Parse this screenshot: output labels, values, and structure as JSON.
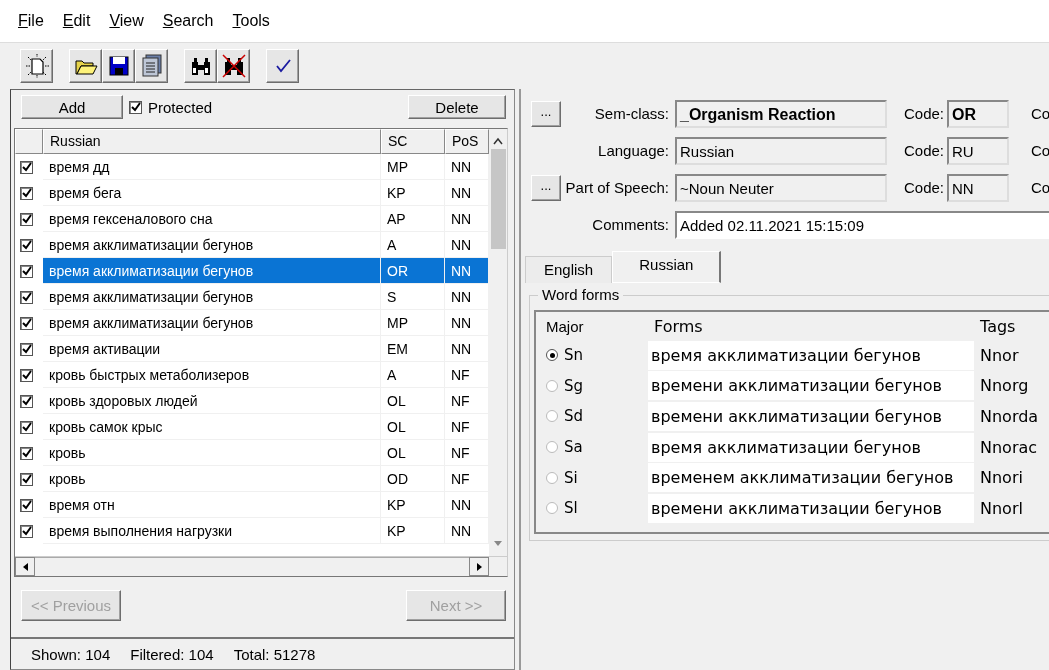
{
  "menu": [
    "File",
    "Edit",
    "View",
    "Search",
    "Tools"
  ],
  "toolbar": [
    [
      {
        "kind": "new"
      }
    ],
    [
      {
        "kind": "open"
      },
      {
        "kind": "save"
      },
      {
        "kind": "save-all"
      }
    ],
    [
      {
        "kind": "find"
      },
      {
        "kind": "find-off"
      }
    ],
    [
      {
        "kind": "check"
      }
    ]
  ],
  "list_panel": {
    "add_button": "Add",
    "protected": {
      "label": "Protected",
      "checked": true
    },
    "delete_button": "Delete",
    "columns": [
      "Russian",
      "SC",
      "PoS"
    ],
    "rows": [
      {
        "checked": true,
        "text": "время дд",
        "sc": "MP",
        "pos": "NN",
        "selected": false
      },
      {
        "checked": true,
        "text": "время бега",
        "sc": "KP",
        "pos": "NN",
        "selected": false
      },
      {
        "checked": true,
        "text": "время гексеналового сна",
        "sc": "AP",
        "pos": "NN",
        "selected": false
      },
      {
        "checked": true,
        "text": "время акклиматизации бегунов",
        "sc": "A",
        "pos": "NN",
        "selected": false
      },
      {
        "checked": true,
        "text": "время акклиматизации бегунов",
        "sc": "OR",
        "pos": "NN",
        "selected": true
      },
      {
        "checked": true,
        "text": "время акклиматизации бегунов",
        "sc": "S",
        "pos": "NN",
        "selected": false
      },
      {
        "checked": true,
        "text": "время акклиматизации бегунов",
        "sc": "MP",
        "pos": "NN",
        "selected": false
      },
      {
        "checked": true,
        "text": "время активации",
        "sc": "EM",
        "pos": "NN",
        "selected": false
      },
      {
        "checked": true,
        "text": "кровь быстрых метаболизеров",
        "sc": "A",
        "pos": "NF",
        "selected": false
      },
      {
        "checked": true,
        "text": "кровь здоровых людей",
        "sc": "OL",
        "pos": "NF",
        "selected": false
      },
      {
        "checked": true,
        "text": "кровь самок крыс",
        "sc": "OL",
        "pos": "NF",
        "selected": false
      },
      {
        "checked": true,
        "text": "кровь",
        "sc": "OL",
        "pos": "NF",
        "selected": false
      },
      {
        "checked": true,
        "text": "кровь",
        "sc": "OD",
        "pos": "NF",
        "selected": false
      },
      {
        "checked": true,
        "text": "время отн",
        "sc": "KP",
        "pos": "NN",
        "selected": false
      },
      {
        "checked": true,
        "text": "время выполнения нагрузки",
        "sc": "KP",
        "pos": "NN",
        "selected": false
      }
    ],
    "nav": [
      {
        "label": "<< Previous",
        "disabled": true
      },
      {
        "label": "Next >>",
        "disabled": true
      }
    ],
    "status": [
      "Shown: 104",
      "Filtered: 104",
      "Total: 51278"
    ]
  },
  "details": {
    "fields": [
      {
        "kind": "lookup",
        "label": "Sem-class:",
        "value": "_Organism Reaction",
        "bold": true,
        "code_label": "Code:",
        "code": "OR",
        "extra": "Co",
        "browse": "..."
      },
      {
        "kind": "plain",
        "label": "Language:",
        "value": "Russian",
        "bold": false,
        "code_label": "Code:",
        "code": "RU",
        "extra": "Co"
      },
      {
        "kind": "lookup",
        "label": "Part of Speech:",
        "value": "~Noun Neuter",
        "bold": false,
        "code_label": "Code:",
        "code": "NN",
        "extra": "Co",
        "browse": "..."
      },
      {
        "kind": "comment",
        "label": "Comments:",
        "value": "Added 02.11.2021  15:15:09"
      }
    ],
    "tabs": [
      {
        "label": "English",
        "selected": false
      },
      {
        "label": "Russian",
        "selected": true
      }
    ],
    "word_forms": {
      "title": "Word forms",
      "columns": [
        "Major",
        "Forms",
        "Tags"
      ],
      "rows": [
        {
          "case": "Sn",
          "selected": true,
          "form": "время акклиматизации бегунов",
          "tag": "Nnor"
        },
        {
          "case": "Sg",
          "selected": false,
          "form": "времени акклиматизации бегунов",
          "tag": "Nnorg"
        },
        {
          "case": "Sd",
          "selected": false,
          "form": "времени акклиматизации бегунов",
          "tag": "Nnorda"
        },
        {
          "case": "Sa",
          "selected": false,
          "form": "время акклиматизации бегунов",
          "tag": "Nnorac"
        },
        {
          "case": "Si",
          "selected": false,
          "form": "временем акклиматизации бегунов",
          "tag": "Nnori"
        },
        {
          "case": "Sl",
          "selected": false,
          "form": "времени акклиматизации бегунов",
          "tag": "Nnorl"
        }
      ]
    }
  }
}
